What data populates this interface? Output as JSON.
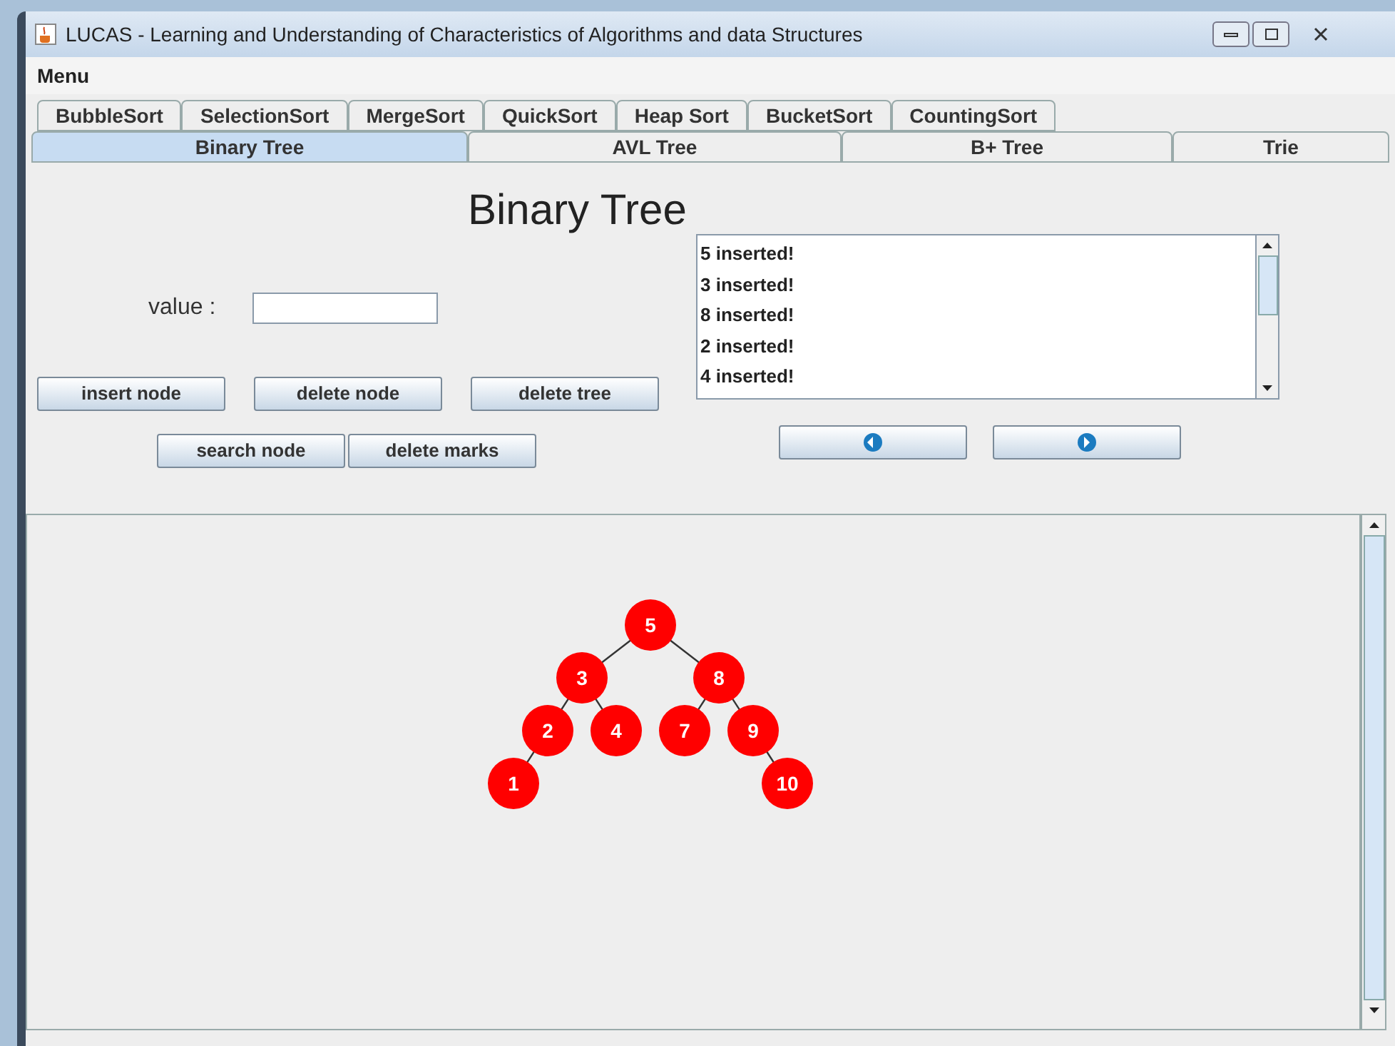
{
  "window": {
    "title": "LUCAS - Learning and Understanding of Characteristics of Algorithms and data Structures"
  },
  "menu": [
    "Menu"
  ],
  "tabs_row1": [
    {
      "label": "BubbleSort",
      "selected": false
    },
    {
      "label": "SelectionSort",
      "selected": false
    },
    {
      "label": "MergeSort",
      "selected": false
    },
    {
      "label": "QuickSort",
      "selected": false
    },
    {
      "label": "Heap Sort",
      "selected": false
    },
    {
      "label": "BucketSort",
      "selected": false
    },
    {
      "label": "CountingSort",
      "selected": false
    }
  ],
  "tabs_row2": [
    {
      "label": "Binary Tree",
      "selected": true
    },
    {
      "label": "AVL Tree",
      "selected": false
    },
    {
      "label": "B+ Tree",
      "selected": false
    },
    {
      "label": "Trie",
      "selected": false
    }
  ],
  "heading": "Binary Tree",
  "value_field": {
    "label": "value :"
  },
  "buttons_row1": [
    "insert node",
    "delete node",
    "delete tree"
  ],
  "buttons_row2": [
    "search node",
    "delete marks"
  ],
  "log": [
    "5 inserted!",
    "3 inserted!",
    "8 inserted!",
    "2 inserted!",
    "4 inserted!"
  ],
  "tree": {
    "value": "5",
    "left": {
      "value": "3",
      "left": {
        "value": "2",
        "left": {
          "value": "1"
        }
      },
      "right": {
        "value": "4"
      }
    },
    "right": {
      "value": "8",
      "left": {
        "value": "7"
      },
      "right": {
        "value": "9",
        "right": {
          "value": "10"
        }
      }
    }
  }
}
